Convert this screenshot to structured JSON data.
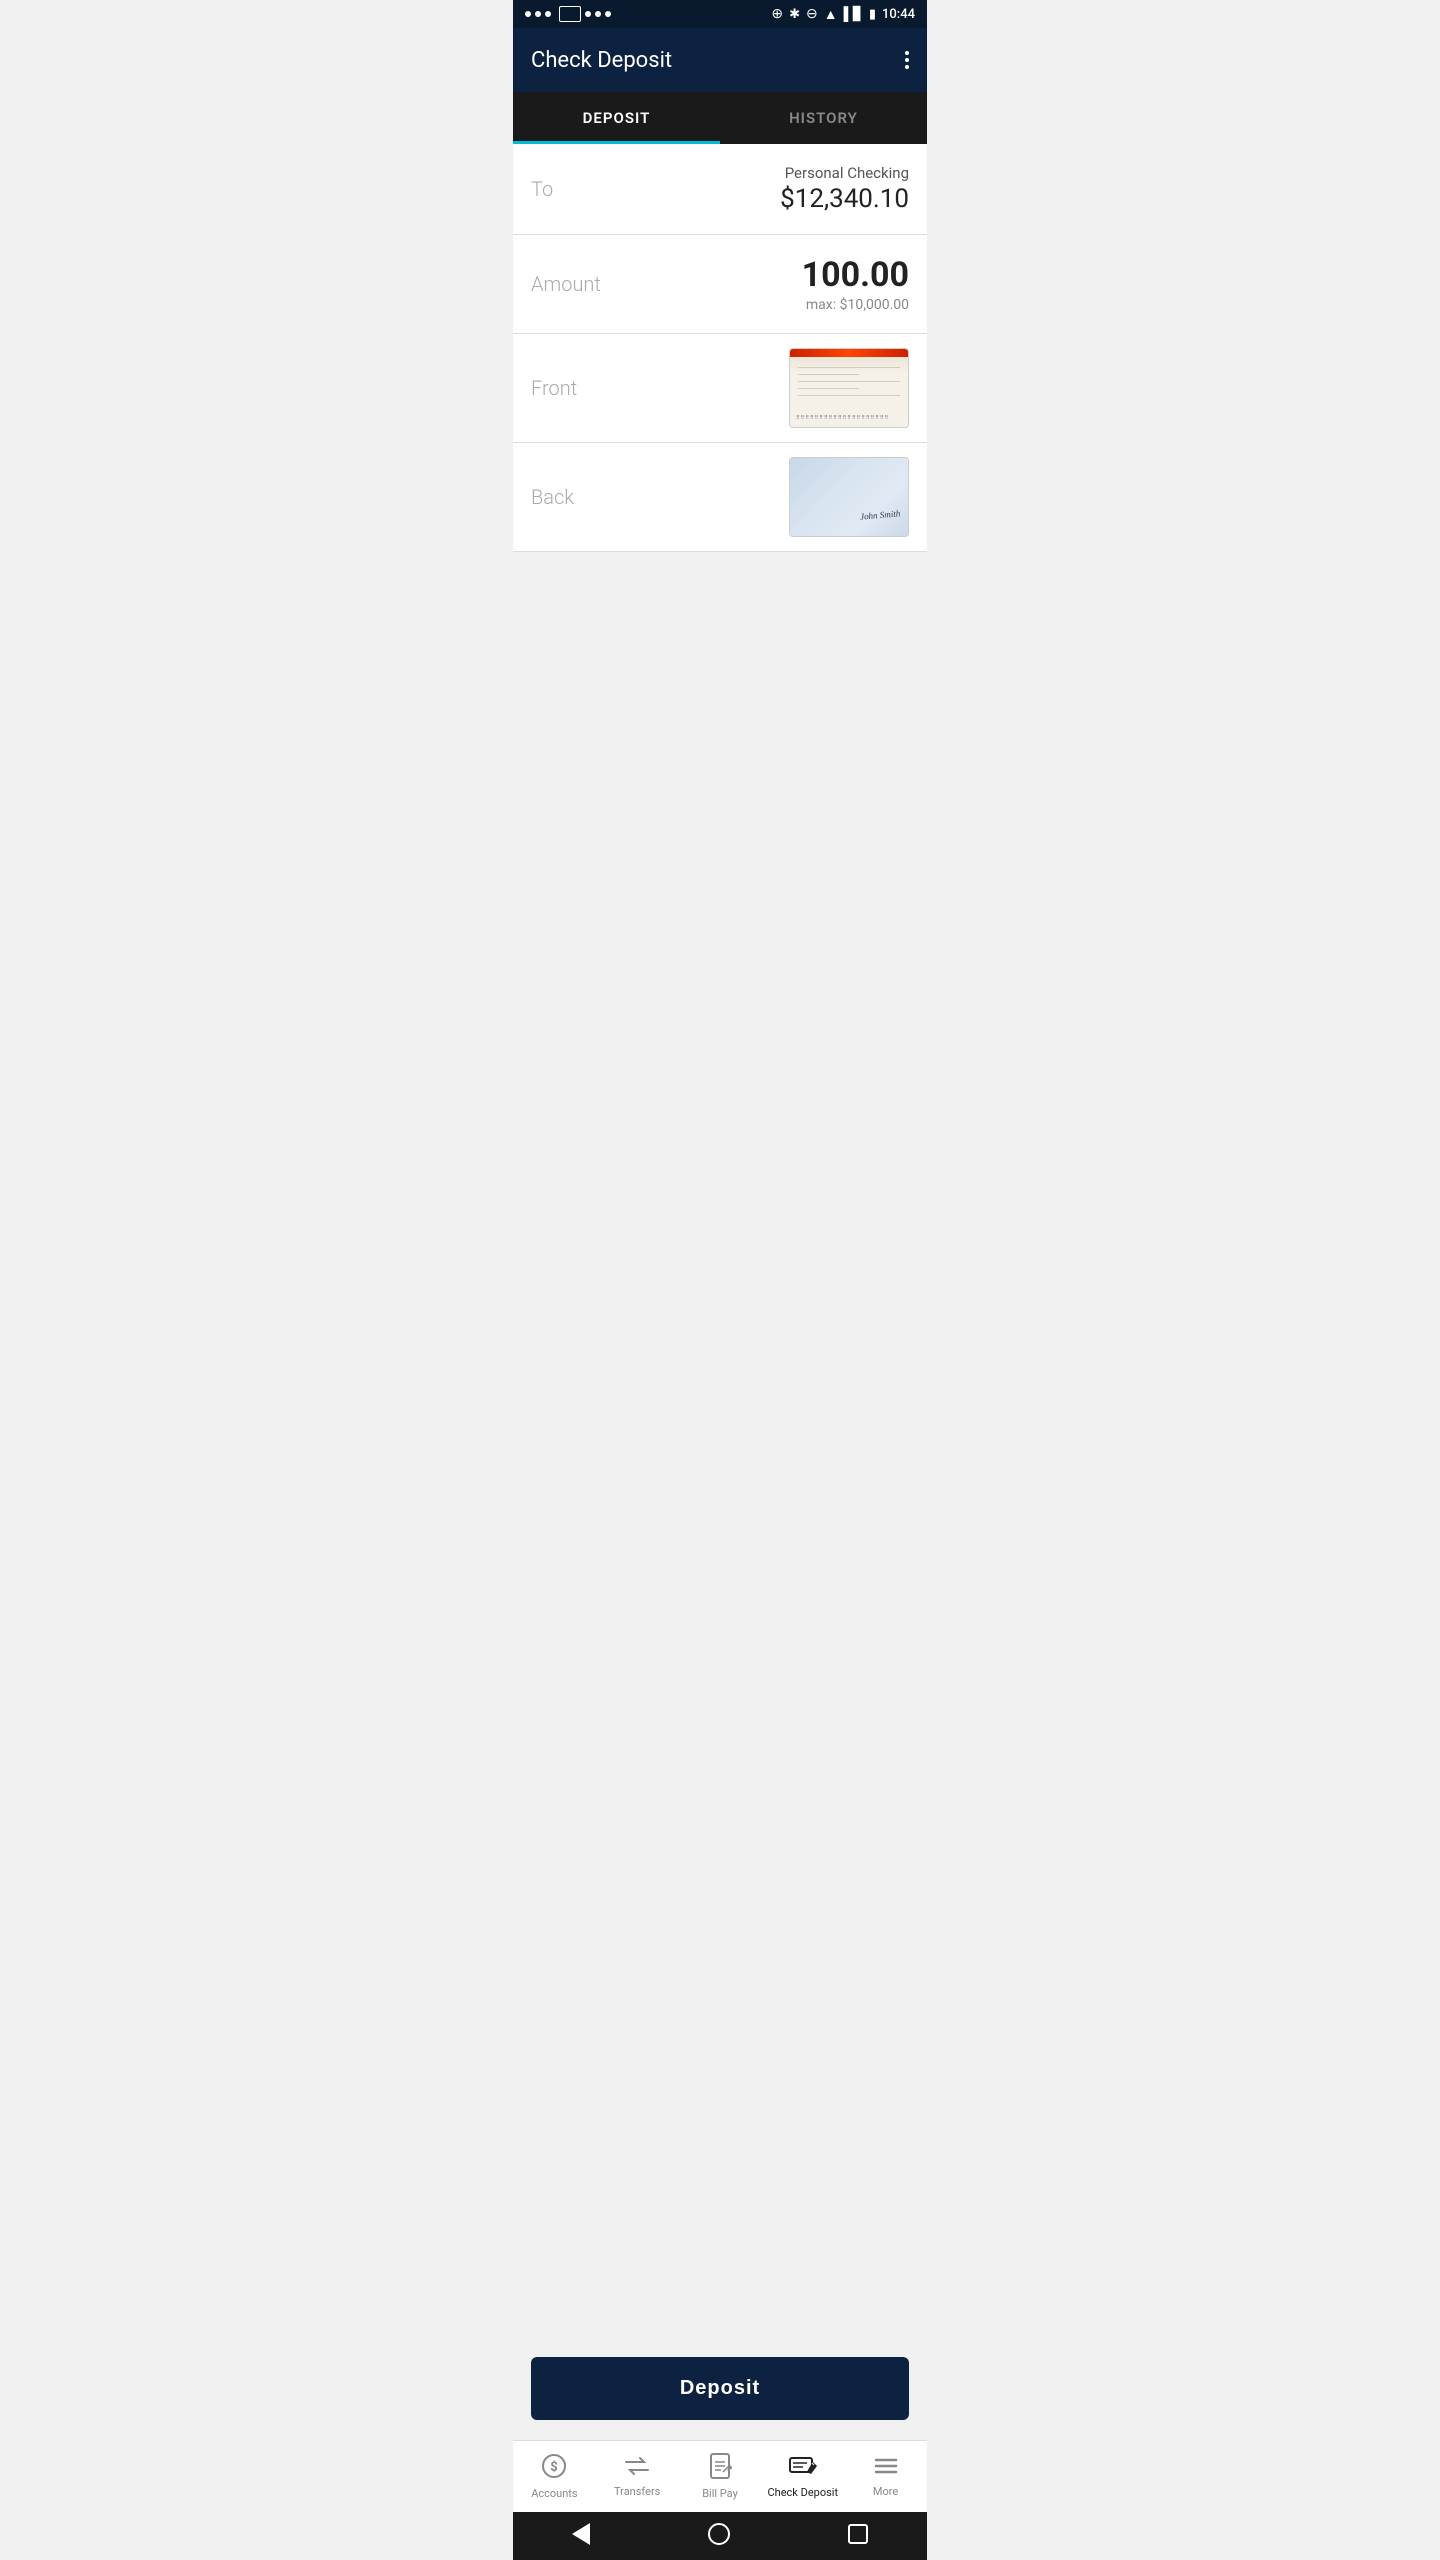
{
  "status_bar": {
    "time": "10:44",
    "icons_left": "...",
    "icons_right": "bluetooth wifi signal battery"
  },
  "header": {
    "title": "Check Deposit",
    "menu_icon": "⋮"
  },
  "tabs": [
    {
      "id": "deposit",
      "label": "DEPOSIT",
      "active": true
    },
    {
      "id": "history",
      "label": "HISTORY",
      "active": false
    }
  ],
  "form": {
    "to_label": "To",
    "account_name": "Personal Checking",
    "account_balance": "$12,340.10",
    "amount_label": "Amount",
    "amount_value": "100.00",
    "amount_max": "max: $10,000.00",
    "front_label": "Front",
    "back_label": "Back"
  },
  "deposit_button": {
    "label": "Deposit"
  },
  "bottom_nav": {
    "items": [
      {
        "id": "accounts",
        "label": "Accounts",
        "icon": "dollar",
        "active": false
      },
      {
        "id": "transfers",
        "label": "Transfers",
        "icon": "transfer",
        "active": false
      },
      {
        "id": "billpay",
        "label": "Bill Pay",
        "icon": "billpay",
        "active": false
      },
      {
        "id": "checkdeposit",
        "label": "Check Deposit",
        "icon": "checkdeposit",
        "active": true
      },
      {
        "id": "more",
        "label": "More",
        "icon": "more",
        "active": false
      }
    ]
  },
  "sys_nav": {
    "back_label": "back",
    "home_label": "home",
    "recents_label": "recents"
  }
}
